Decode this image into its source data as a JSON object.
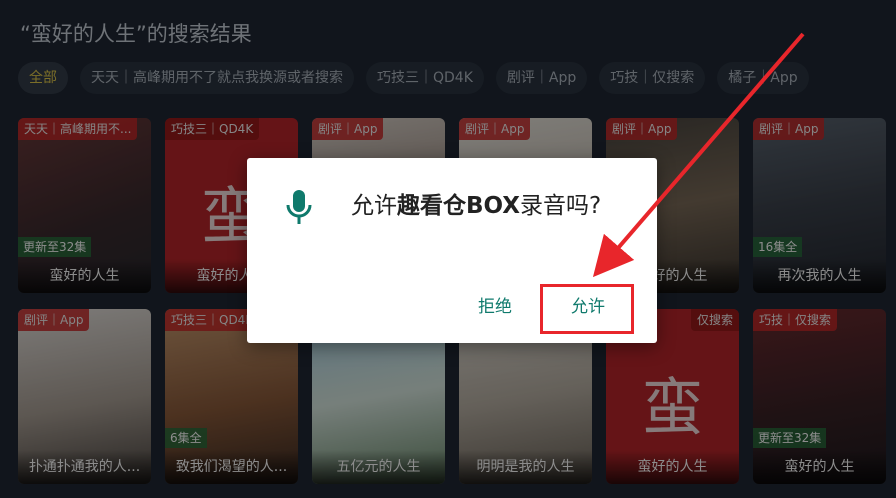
{
  "header": {
    "title": "“蛮好的人生”的搜索结果"
  },
  "filters": [
    {
      "label": "全部"
    },
    {
      "label": "天天｜高峰期用不了就点我换源或者搜索"
    },
    {
      "label": "巧技三｜QD4K"
    },
    {
      "label": "剧评｜App"
    },
    {
      "label": "巧技｜仅搜索"
    },
    {
      "label": "橘子｜App"
    }
  ],
  "results_row1": [
    {
      "source": "天天｜高峰期用不...",
      "title": "蛮好的人生",
      "badge": "更新至32集"
    },
    {
      "source": "巧技三｜QD4K",
      "title": "蛮好的人生",
      "big_char": "蛮"
    },
    {
      "source": "剧评｜App",
      "title": ""
    },
    {
      "source": "剧评｜App",
      "title": ""
    },
    {
      "source": "剧评｜App",
      "title": "蛮好的人生"
    },
    {
      "source": "剧评｜App",
      "title": "再次我的人生",
      "badge": "16集全"
    }
  ],
  "results_row2": [
    {
      "source": "剧评｜App",
      "title": "扑通扑通我的人..."
    },
    {
      "source": "巧技三｜QD4K",
      "title": "致我们渴望的人...",
      "badge": "6集全"
    },
    {
      "source": "",
      "title": "五亿元的人生"
    },
    {
      "source": "",
      "title": "明明是我的人生"
    },
    {
      "source": "仅搜索",
      "title": "蛮好的人生",
      "big_char": "蛮"
    },
    {
      "source": "巧技｜仅搜索",
      "title": "蛮好的人生",
      "badge": "更新至32集"
    }
  ],
  "dialog": {
    "prefix": "允许",
    "app_name": "趣看仓BOX",
    "suffix": "录音吗?",
    "deny_label": "拒绝",
    "allow_label": "允许"
  },
  "colors": {
    "accent": "#0f7a6c",
    "annotation": "#e8262b"
  }
}
